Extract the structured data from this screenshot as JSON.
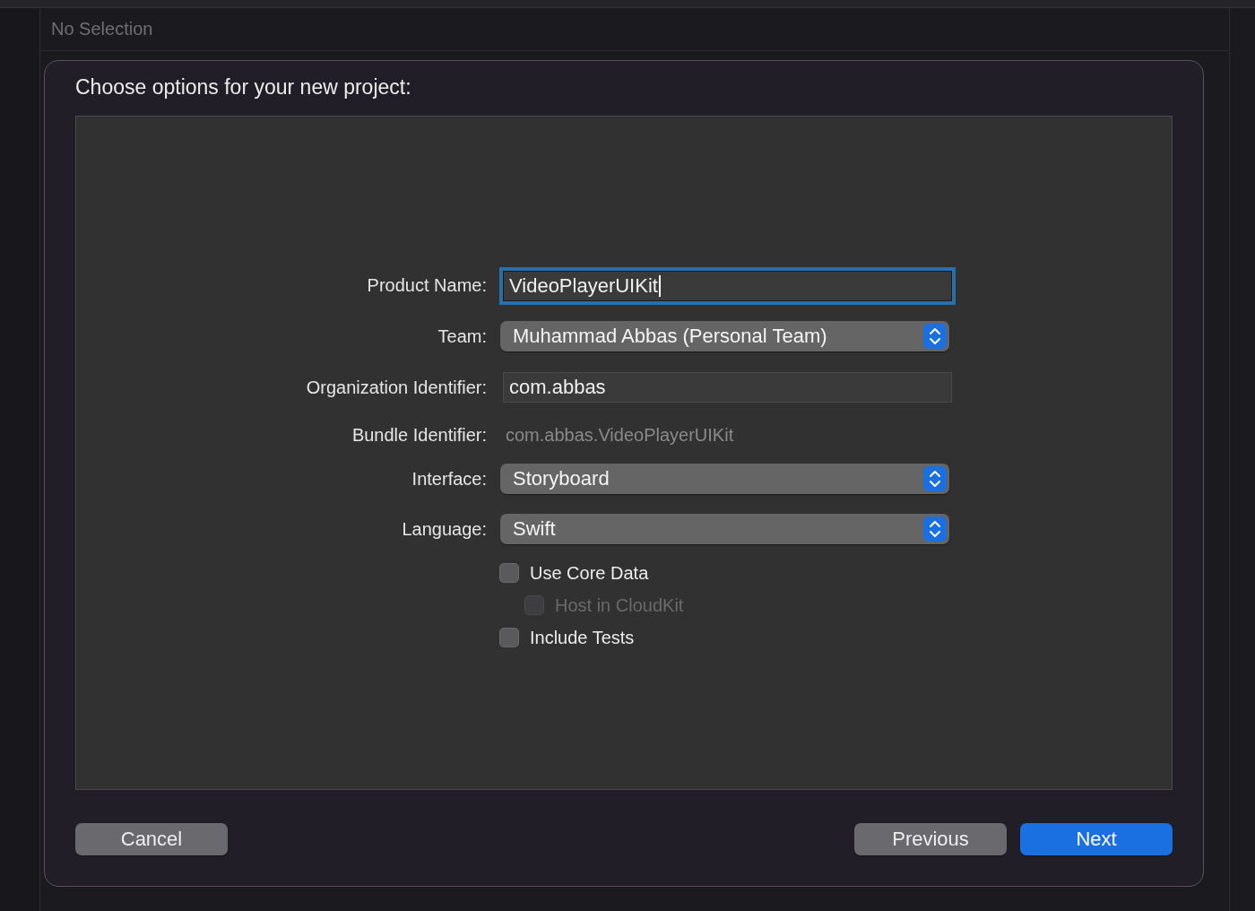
{
  "header": {
    "text": "No Selection"
  },
  "dialog": {
    "title": "Choose options for your new project:",
    "fields": [
      {
        "kind": "text",
        "label": "Product Name:",
        "value": "VideoPlayerUIKit",
        "focused": true
      },
      {
        "kind": "popup",
        "label": "Team:",
        "value": "Muhammad Abbas (Personal Team)"
      },
      {
        "kind": "text",
        "label": "Organization Identifier:",
        "value": "com.abbas",
        "focused": false
      },
      {
        "kind": "static",
        "label": "Bundle Identifier:",
        "value": "com.abbas.VideoPlayerUIKit"
      },
      {
        "kind": "popup",
        "label": "Interface:",
        "value": "Storyboard"
      },
      {
        "kind": "popup",
        "label": "Language:",
        "value": "Swift"
      }
    ],
    "options": [
      {
        "label": "Use Core Data",
        "checked": false,
        "disabled": false,
        "children": [
          {
            "label": "Host in CloudKit",
            "checked": false,
            "disabled": true
          }
        ]
      },
      {
        "label": "Include Tests",
        "checked": false,
        "disabled": false
      }
    ],
    "buttons": [
      {
        "label": "Cancel",
        "default": false
      },
      {
        "label": "Previous",
        "default": false
      },
      {
        "label": "Next",
        "default": true
      }
    ]
  }
}
